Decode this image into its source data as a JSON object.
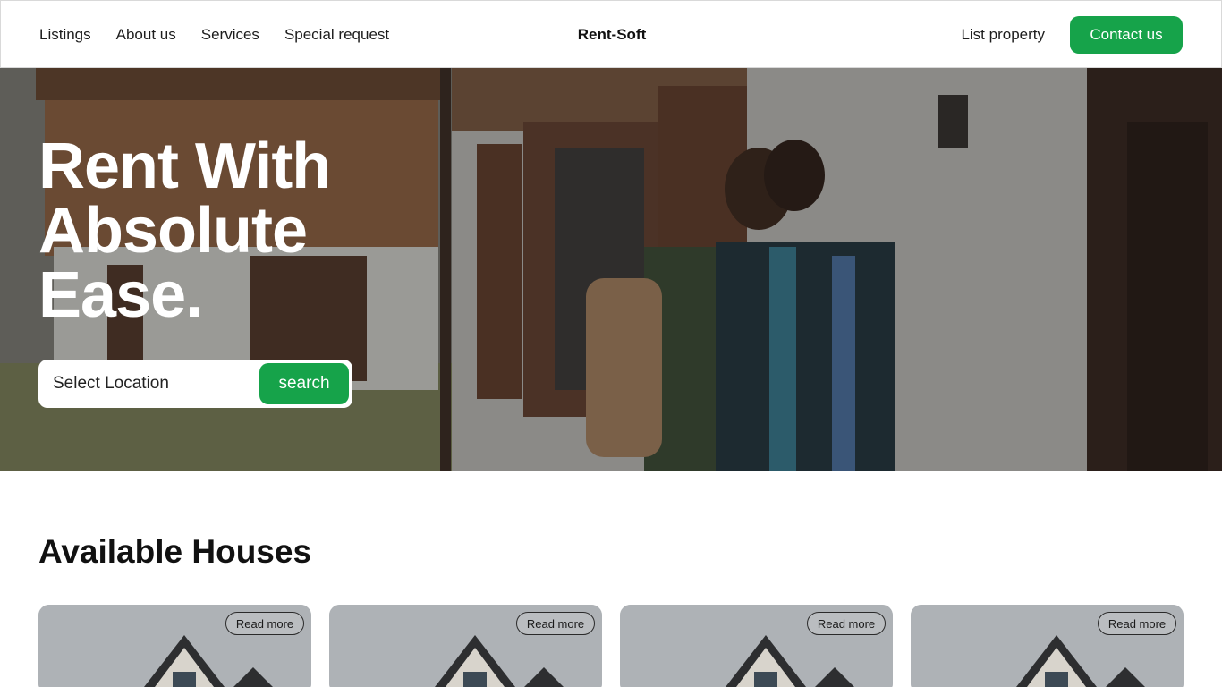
{
  "nav": {
    "links": [
      "Listings",
      "About us",
      "Services",
      "Special request"
    ],
    "brand": "Rent-Soft",
    "list_property": "List property",
    "contact": "Contact us"
  },
  "hero": {
    "title": "Rent With Absolute Ease.",
    "search_placeholder": "Select Location",
    "search_button": "search"
  },
  "houses": {
    "title": "Available Houses",
    "cards": [
      {
        "read_more": "Read more"
      },
      {
        "read_more": "Read more"
      },
      {
        "read_more": "Read more"
      },
      {
        "read_more": "Read more"
      }
    ]
  },
  "colors": {
    "accent": "#16a34a"
  }
}
